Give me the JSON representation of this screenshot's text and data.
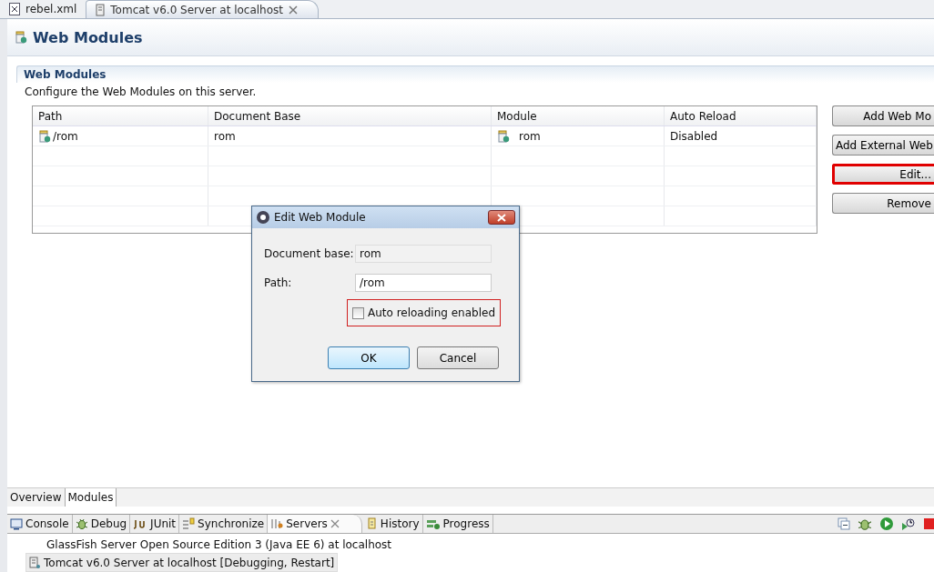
{
  "editor_tabs": [
    {
      "label": "rebel.xml",
      "selected": false
    },
    {
      "label": "Tomcat v6.0 Server at localhost",
      "selected": true
    }
  ],
  "page_title": "Web Modules",
  "section": {
    "title": "Web Modules",
    "description": "Configure the Web Modules on this server."
  },
  "table": {
    "columns": [
      "Path",
      "Document Base",
      "Module",
      "Auto Reload"
    ],
    "rows": [
      {
        "path": "/rom",
        "document_base": "rom",
        "module": "rom",
        "auto_reload": "Disabled"
      }
    ]
  },
  "buttons": [
    {
      "label": "Add Web Mo",
      "highlighted": false
    },
    {
      "label": "Add External Web",
      "highlighted": false
    },
    {
      "label": "Edit...",
      "highlighted": true
    },
    {
      "label": "Remove",
      "highlighted": false
    }
  ],
  "dialog": {
    "title": "Edit Web Module",
    "fields": [
      {
        "label": "Document base:",
        "value": "rom",
        "disabled": true
      },
      {
        "label": "Path:",
        "value": "/rom",
        "disabled": false
      }
    ],
    "checkbox": {
      "label": "Auto reloading enabled",
      "checked": false,
      "highlighted": true
    },
    "buttons": [
      {
        "label": "OK",
        "default": true
      },
      {
        "label": "Cancel",
        "default": false
      }
    ]
  },
  "page_tabs": [
    {
      "label": "Overview",
      "selected": false
    },
    {
      "label": "Modules",
      "selected": true
    }
  ],
  "view_tabs": [
    {
      "label": "Console",
      "selected": false
    },
    {
      "label": "Debug",
      "selected": false
    },
    {
      "label": "JUnit",
      "selected": false
    },
    {
      "label": "Synchronize",
      "selected": false
    },
    {
      "label": "Servers",
      "selected": true
    },
    {
      "label": "History",
      "selected": false
    },
    {
      "label": "Progress",
      "selected": false
    }
  ],
  "servers": [
    {
      "label": "GlassFish Server Open Source Edition 3 (Java EE 6) at localhost",
      "selected": false
    },
    {
      "label": "Tomcat v6.0 Server at localhost  [Debugging, Restart]",
      "selected": true
    }
  ]
}
